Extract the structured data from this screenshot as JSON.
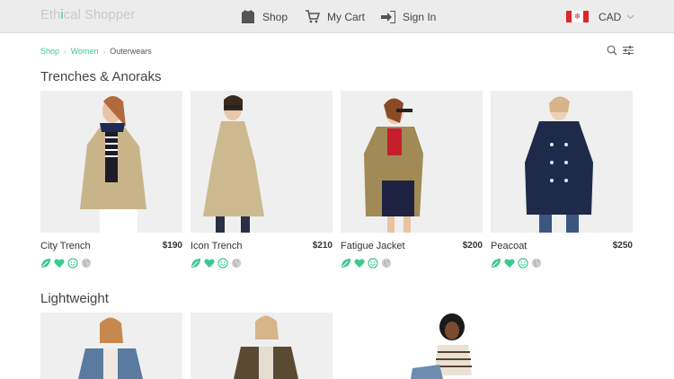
{
  "header": {
    "logo_prefix": "Eth",
    "logo_accent": "i",
    "logo_suffix": "cal Shopper",
    "nav": {
      "shop": "Shop",
      "cart": "My Cart",
      "signin": "Sign In"
    },
    "currency": "CAD",
    "flag_icon": "canada-flag-icon"
  },
  "breadcrumb": {
    "items": [
      "Shop",
      "Women",
      "Outerwears"
    ]
  },
  "sections": [
    {
      "title": "Trenches & Anoraks",
      "products": [
        {
          "name": "City Trench",
          "price": "$190",
          "coat_color": "#c9b48a"
        },
        {
          "name": "Icon Trench",
          "price": "$210",
          "coat_color": "#cdb98f"
        },
        {
          "name": "Fatigue Jacket",
          "price": "$200",
          "coat_color": "#a18a55"
        },
        {
          "name": "Peacoat",
          "price": "$250",
          "coat_color": "#1e2a4a"
        }
      ],
      "badge_icons": [
        "leaf-icon",
        "heart-icon",
        "smiley-icon",
        "globe-icon"
      ]
    },
    {
      "title": "Lightweight",
      "products": [
        {
          "coat_color": "#5a7aa0"
        },
        {
          "coat_color": "#5b4a32"
        },
        {
          "coat_color": "#e9e2d3"
        }
      ]
    }
  ],
  "colors": {
    "accent": "#3cc98f",
    "header_bg": "#ececec",
    "photo_bg": "#efefef"
  }
}
